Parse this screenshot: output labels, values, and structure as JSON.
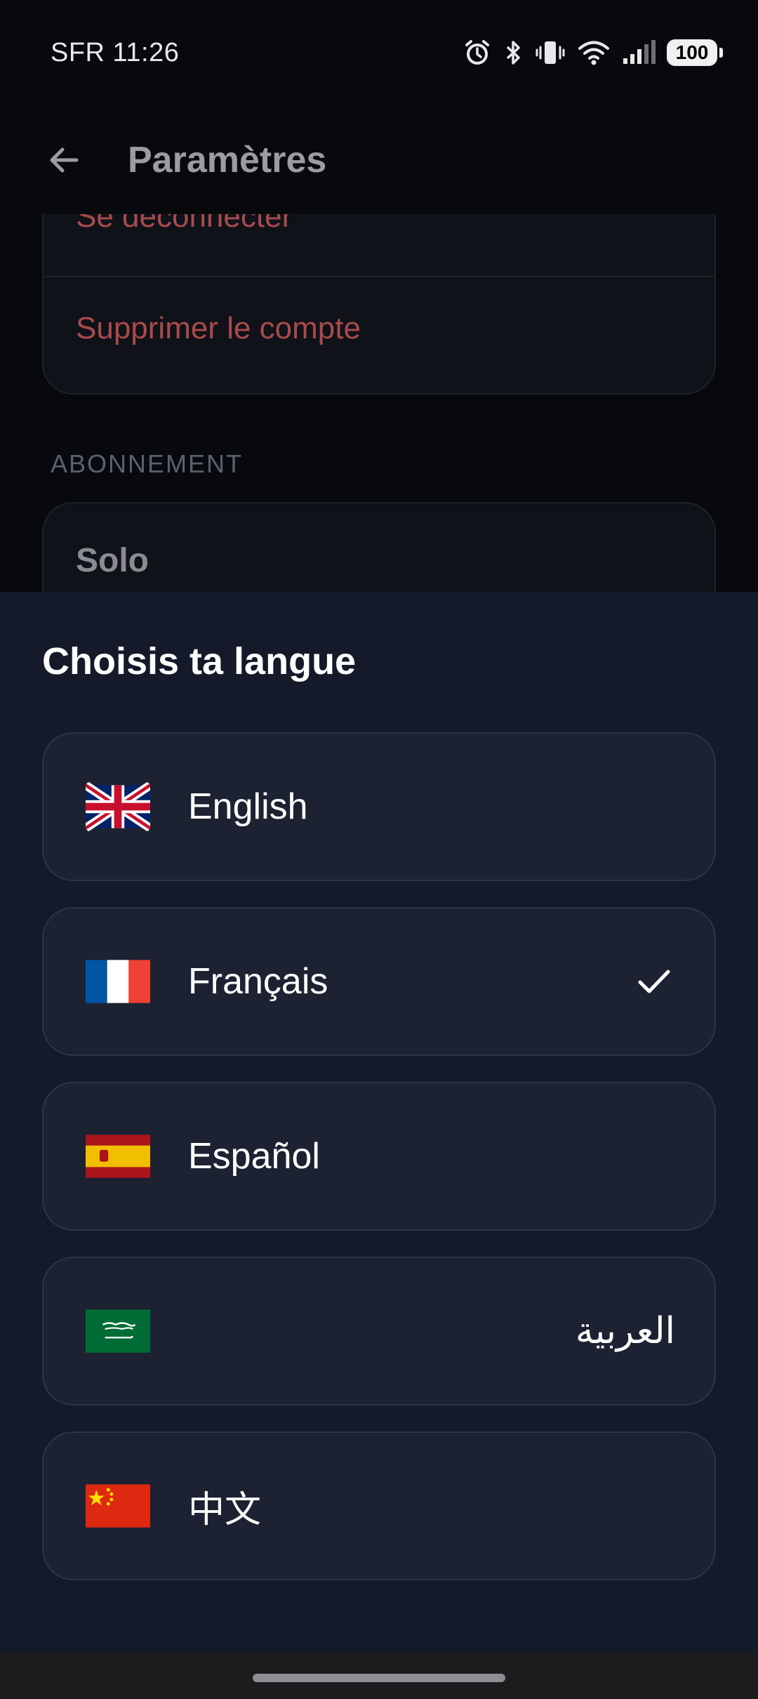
{
  "status_bar": {
    "carrier_time": "SFR 11:26",
    "battery": "100",
    "icons": [
      "alarm-icon",
      "bluetooth-icon",
      "vibrate-icon",
      "wifi-icon",
      "signal-icon",
      "battery-icon"
    ]
  },
  "app_bar": {
    "title": "Paramètres",
    "back_icon": "arrow-left-icon"
  },
  "settings": {
    "account_actions": [
      "Se déconnecter",
      "Supprimer le compte"
    ],
    "subscription_section": "ABONNEMENT",
    "subscription_plan": "Solo",
    "danger_color": "#a84a4d"
  },
  "language_sheet": {
    "title": "Choisis ta langue",
    "options": [
      {
        "label": "English",
        "flag": "uk-flag-icon",
        "selected": false
      },
      {
        "label": "Français",
        "flag": "france-flag-icon",
        "selected": true
      },
      {
        "label": "Español",
        "flag": "spain-flag-icon",
        "selected": false
      },
      {
        "label": "العربية",
        "flag": "saudi-arabia-flag-icon",
        "selected": false
      },
      {
        "label": "中文",
        "flag": "china-flag-icon",
        "selected": false
      }
    ],
    "selected_icon": "check-icon"
  }
}
